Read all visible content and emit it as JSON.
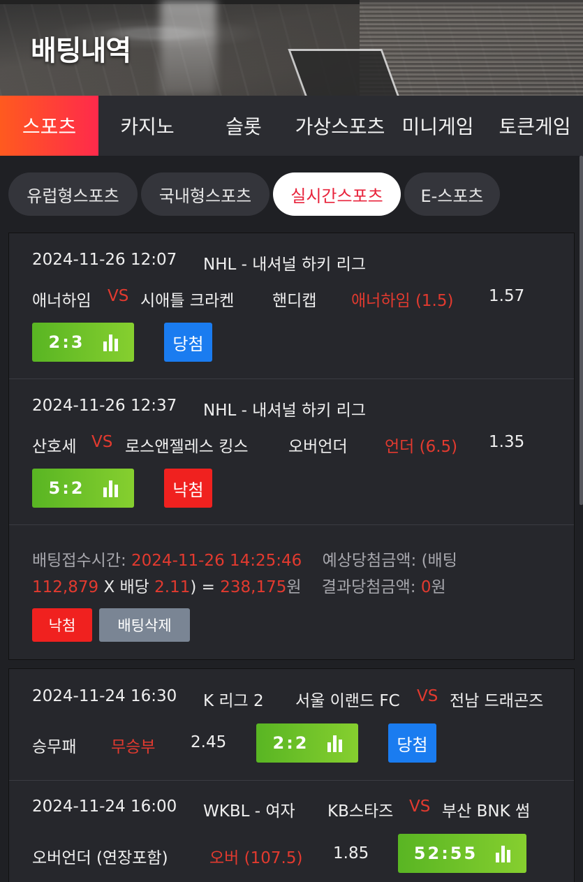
{
  "header": {
    "title": "배팅내역"
  },
  "category_tabs": [
    {
      "label": "스포츠",
      "active": true
    },
    {
      "label": "카지노",
      "active": false
    },
    {
      "label": "슬롯",
      "active": false
    },
    {
      "label": "가상스포츠",
      "active": false
    },
    {
      "label": "미니게임",
      "active": false
    },
    {
      "label": "토큰게임",
      "active": false
    }
  ],
  "sub_tabs": [
    {
      "label": "유럽형스포츠",
      "active": false
    },
    {
      "label": "국내형스포츠",
      "active": false
    },
    {
      "label": "실시간스포츠",
      "active": true
    },
    {
      "label": "E-스포츠",
      "active": false
    }
  ],
  "vs_label": "VS",
  "card1": {
    "bets": [
      {
        "datetime": "2024-11-26 12:07",
        "league": "NHL - 내셔널 하키 리그",
        "home": "애너하임",
        "away": "시애틀 크라켄",
        "market": "핸디캡",
        "pick": "애너하임 (1.5)",
        "odds": "1.57",
        "score": "2:3",
        "result": "당첨"
      },
      {
        "datetime": "2024-11-26 12:37",
        "league": "NHL - 내셔널 하키 리그",
        "home": "산호세",
        "away": "로스앤젤레스 킹스",
        "market": "오버언더",
        "pick": "언더 (6.5)",
        "odds": "1.35",
        "score": "5:2",
        "result": "낙첨"
      }
    ],
    "summary": {
      "time_label": "배팅접수시간:",
      "time_value": "2024-11-26 14:25:46",
      "expected_label": "예상당첨금액: (배팅",
      "stake": "112,879",
      "times_label": "X 배당",
      "total_odds": "2.11",
      "eq": ") =",
      "expected_amount": "238,175",
      "won_unit": "원",
      "result_label": "결과당첨금액:",
      "result_amount": "0",
      "result_button": "낙첨",
      "delete_button": "배팅삭제"
    }
  },
  "card2": {
    "bets": [
      {
        "datetime": "2024-11-24 16:30",
        "league": "K 리그 2",
        "home": "서울 이랜드 FC",
        "away": "전남 드래곤즈",
        "market": "승무패",
        "pick": "무승부",
        "odds": "2.45",
        "score": "2:2",
        "result": "당첨"
      },
      {
        "datetime": "2024-11-24 16:00",
        "league": "WKBL - 여자",
        "home": "KB스타즈",
        "away": "부산 BNK 썸",
        "market": "오버언더 (연장포함)",
        "pick": "오버 (107.5)",
        "odds": "1.85",
        "score": "52:55"
      }
    ]
  },
  "colors": {
    "accent_red": "#e23a2f",
    "win_blue": "#1a7cf0",
    "lose_red": "#f0211f",
    "score_green": "#6cc228"
  }
}
